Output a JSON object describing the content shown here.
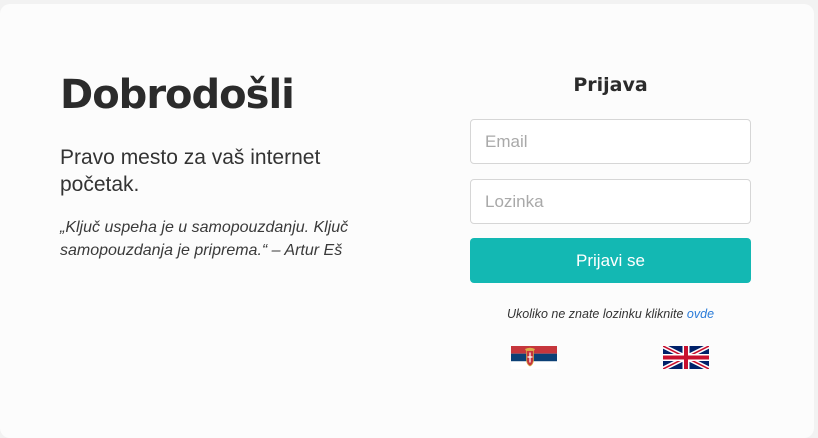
{
  "welcome": {
    "title": "Dobrodošli",
    "subtitle": "Pravo mesto za vaš internet početak.",
    "quote": "„Ključ uspeha je u samopouzdanju. Ključ samopouzdanja je priprema.“ – Artur Eš"
  },
  "login": {
    "title": "Prijava",
    "email_placeholder": "Email",
    "email_value": "",
    "password_placeholder": "Lozinka",
    "password_value": "",
    "submit_label": "Prijavi se",
    "forgot_text": "Ukoliko ne znate lozinku kliknite ",
    "forgot_link": "ovde"
  },
  "languages": [
    {
      "icon": "serbian-flag-icon"
    },
    {
      "icon": "uk-flag-icon"
    }
  ],
  "colors": {
    "accent": "#13b8b3",
    "link": "#2a7bd8",
    "background": "#fcfcfc"
  }
}
